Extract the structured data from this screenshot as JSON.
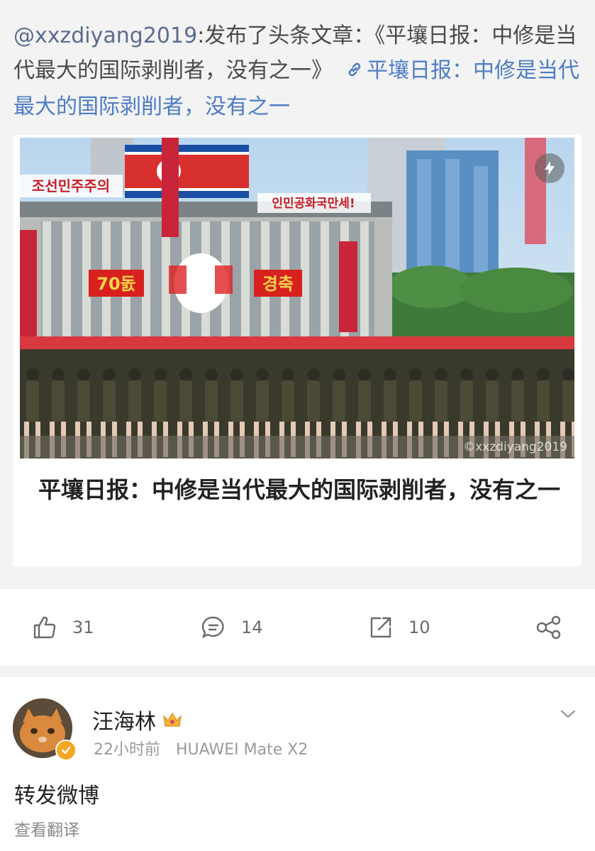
{
  "post": {
    "mention": "@xxzdiyang2019",
    "text": ":发布了头条文章：《平壤日报：中修是当代最大的国际剥削者，没有之一》",
    "link_text": "平壤日报：中修是当代最大的国际剥削者，没有之一"
  },
  "card": {
    "title": "平壤日报：中修是当代最大的国际剥削者，没有之一",
    "banner_left": "조선민주주의",
    "banner_center": "인민공화국만세!",
    "sign_70": "70돐",
    "sign_celebrate": "경축",
    "watermark": "©xxzdiyang2019"
  },
  "actions": {
    "likes": "31",
    "comments": "14",
    "reposts": "10"
  },
  "comment": {
    "username": "汪海林",
    "time": "22小时前",
    "device": "HUAWEI Mate X2",
    "text": "转发微博",
    "translate": "查看翻译"
  },
  "colors": {
    "background_gray": "#f3f3f3",
    "link_blue": "#4e7cc6",
    "mention": "#5b6c8f"
  },
  "icons": [
    "link-icon",
    "flash-icon",
    "like-icon",
    "comment-icon",
    "repost-icon",
    "share-icon",
    "verified-icon",
    "crown-icon",
    "chevron-down-icon"
  ]
}
